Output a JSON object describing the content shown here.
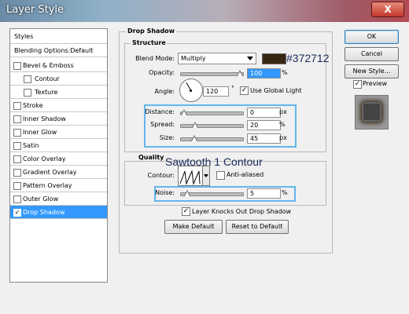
{
  "window": {
    "title": "Layer Style",
    "close_glyph": "X"
  },
  "styles_panel": {
    "header": "Styles",
    "blending_options": "Blending Options:Default",
    "items": [
      {
        "label": "Bevel & Emboss",
        "checked": false
      },
      {
        "label": "Contour",
        "checked": false,
        "indent": true
      },
      {
        "label": "Texture",
        "checked": false,
        "indent": true
      },
      {
        "label": "Stroke",
        "checked": false
      },
      {
        "label": "Inner Shadow",
        "checked": false
      },
      {
        "label": "Inner Glow",
        "checked": false
      },
      {
        "label": "Satin",
        "checked": false
      },
      {
        "label": "Color Overlay",
        "checked": false
      },
      {
        "label": "Gradient Overlay",
        "checked": false
      },
      {
        "label": "Pattern Overlay",
        "checked": false
      },
      {
        "label": "Outer Glow",
        "checked": false
      },
      {
        "label": "Drop Shadow",
        "checked": true,
        "selected": true
      }
    ]
  },
  "drop_shadow": {
    "title": "Drop Shadow",
    "structure": {
      "title": "Structure",
      "blend_mode_label": "Blend Mode:",
      "blend_mode_value": "Multiply",
      "color_swatch": "#372712",
      "color_hex_annotation": "#372712",
      "opacity_label": "Opacity:",
      "opacity_value": "100",
      "opacity_unit": "%",
      "opacity_fraction": 1.0,
      "angle_label": "Angle:",
      "angle_value": "120",
      "angle_unit": "°",
      "use_global_light_label": "Use Global Light",
      "use_global_light_checked": true,
      "distance_label": "Distance:",
      "distance_value": "0",
      "distance_unit": "px",
      "distance_fraction": 0.0,
      "spread_label": "Spread:",
      "spread_value": "20",
      "spread_unit": "%",
      "spread_fraction": 0.2,
      "size_label": "Size:",
      "size_value": "45",
      "size_unit": "px",
      "size_fraction": 0.18
    },
    "quality": {
      "title": "Quality",
      "contour_label": "Contour:",
      "contour_annotation": "Sawtooth 1 Contour",
      "anti_aliased_label": "Anti-aliased",
      "anti_aliased_checked": false,
      "noise_label": "Noise:",
      "noise_value": "5",
      "noise_unit": "%",
      "noise_fraction": 0.05
    },
    "layer_knocks_out_label": "Layer Knocks Out Drop Shadow",
    "layer_knocks_out_checked": true,
    "make_default_label": "Make Default",
    "reset_to_default_label": "Reset to Default"
  },
  "right_buttons": {
    "ok": "OK",
    "cancel": "Cancel",
    "new_style": "New Style...",
    "preview_label": "Preview",
    "preview_checked": true
  },
  "check_glyph": "✓"
}
